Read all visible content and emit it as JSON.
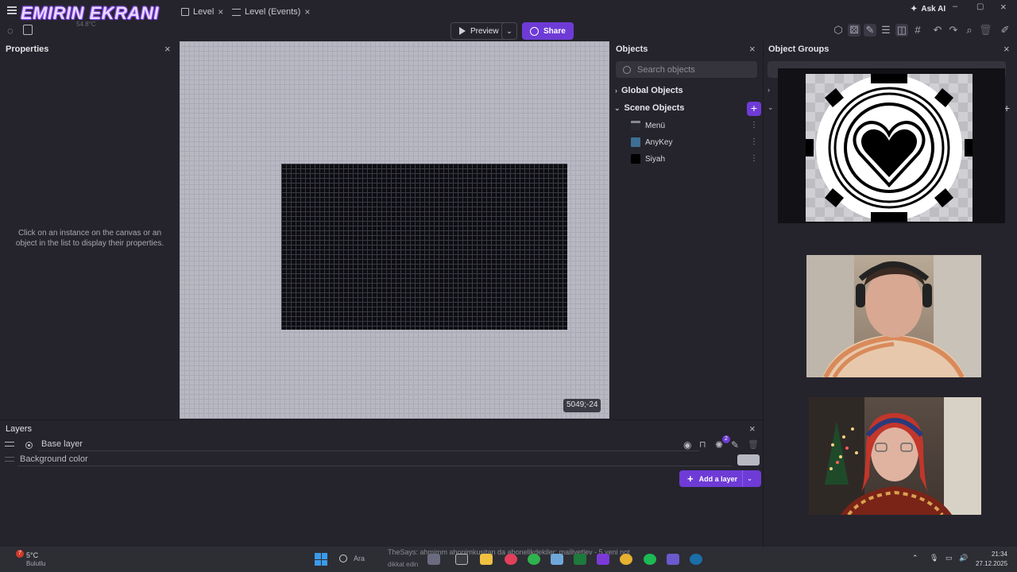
{
  "overlay": {
    "stream_title": "EMIRIN EKRANI",
    "weather_small": "54.8°C"
  },
  "tabs": [
    {
      "label": "Level"
    },
    {
      "label": "Level (Events)"
    }
  ],
  "titlebar": {
    "ask_ai": "Ask AI"
  },
  "toolbar": {
    "preview_label": "Preview",
    "share_label": "Share"
  },
  "properties": {
    "title": "Properties",
    "empty_hint": "Click on an instance on the canvas or an object in the list to display their properties."
  },
  "canvas": {
    "coordinates": "5049;-24"
  },
  "objects": {
    "title": "Objects",
    "search_placeholder": "Search objects",
    "global_label": "Global Objects",
    "scene_label": "Scene Objects",
    "items": [
      {
        "label": "Menü"
      },
      {
        "label": "AnyKey"
      },
      {
        "label": "Siyah"
      }
    ]
  },
  "object_groups": {
    "title": "Object Groups"
  },
  "layers": {
    "title": "Layers",
    "base_layer": "Base layer",
    "background_color": "Background color",
    "add_layer": "Add a layer",
    "badge_count": "2"
  },
  "taskbar": {
    "weather_temp": "5°C",
    "weather_desc": "Bulutlu",
    "weather_badge": "7",
    "search_label": "Ara",
    "notification_text": "TheSays: ahmimm ahonimkusitan da abonelikdekiler: mailiyetlev - 5 yeni not",
    "notification_text2": "dikkat edin",
    "time": "21:34",
    "date": "27.12.2025"
  },
  "colors": {
    "accent": "#6e3bd6",
    "background": "#25242c",
    "canvas": "#b7b8c2",
    "scene_black": "#0d0d12"
  }
}
